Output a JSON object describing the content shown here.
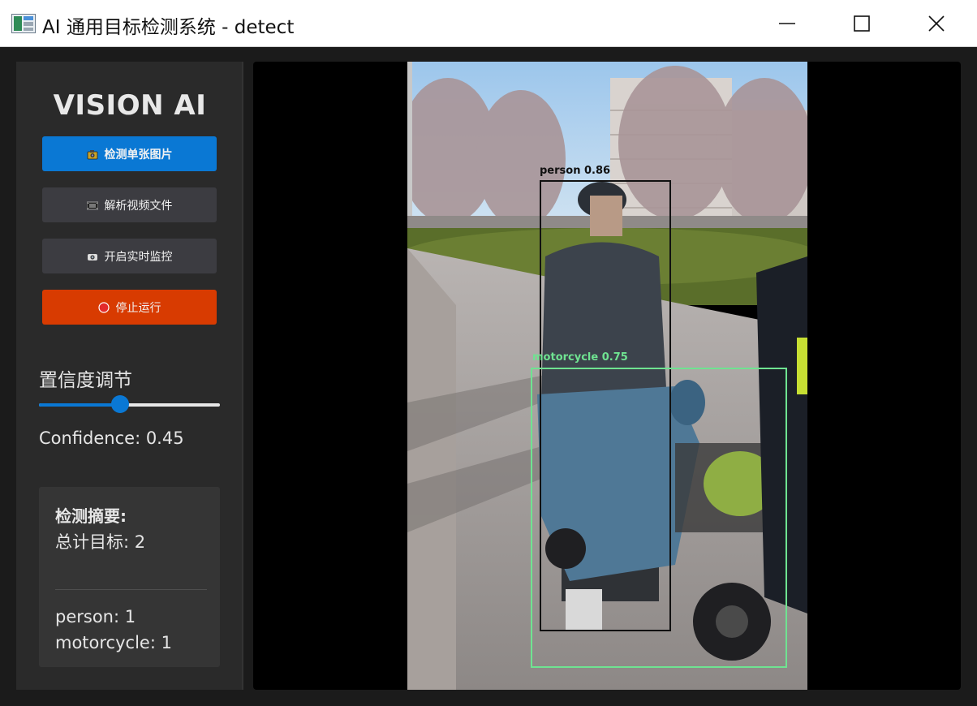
{
  "window": {
    "title": "AI 通用目标检测系统 - detect",
    "controls": {
      "minimize": "minimize",
      "maximize": "maximize",
      "close": "close"
    }
  },
  "sidebar": {
    "brand": "VISION AI",
    "buttons": {
      "detect_image": "检测单张图片",
      "parse_video": "解析视频文件",
      "realtime": "开启实时监控",
      "stop": "停止运行"
    },
    "confidence": {
      "title": "置信度调节",
      "value": 0.45,
      "label": "Confidence: 0.45"
    },
    "summary": {
      "title": "检测摘要:",
      "total": "总计目标: 2",
      "classes": [
        "person: 1",
        "motorcycle: 1"
      ]
    }
  },
  "viewer": {
    "detections": [
      {
        "label": "person 0.86",
        "color": "#111111"
      },
      {
        "label": "motorcycle 0.75",
        "color": "#6fe391"
      }
    ]
  },
  "colors": {
    "accent": "#0a78d4",
    "danger": "#d83b01",
    "secondary": "#3c3c41"
  },
  "icons": {
    "detect_image": "camera-icon",
    "parse_video": "film-icon",
    "realtime": "camera-lens-icon",
    "stop": "stop-circle-icon"
  }
}
